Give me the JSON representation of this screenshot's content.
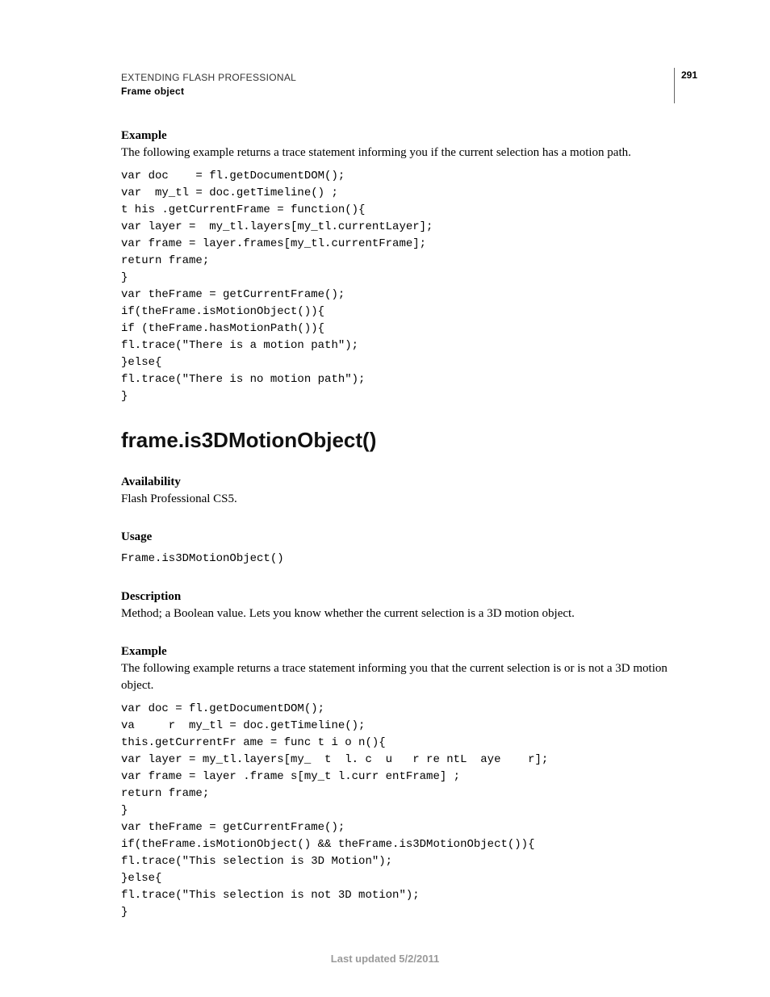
{
  "header": {
    "line1": "EXTENDING FLASH PROFESSIONAL",
    "line2": "Frame object",
    "page_number": "291"
  },
  "section1": {
    "label": "Example",
    "intro": "The following example returns a trace statement informing you if the current selection has a motion path.",
    "code": "var doc    = fl.getDocumentDOM();\nvar  my_tl = doc.getTimeline() ;\nt his .getCurrentFrame = function(){\nvar layer =  my_tl.layers[my_tl.currentLayer];\nvar frame = layer.frames[my_tl.currentFrame];\nreturn frame;\n}\nvar theFrame = getCurrentFrame();\nif(theFrame.isMotionObject()){\nif (theFrame.hasMotionPath()){\nfl.trace(\"There is a motion path\");\n}else{\nfl.trace(\"There is no motion path\");\n}"
  },
  "api": {
    "heading": "frame.is3DMotionObject()",
    "availability": {
      "label": "Availability",
      "text": "Flash Professional CS5."
    },
    "usage": {
      "label": "Usage",
      "code": "Frame.is3DMotionObject()"
    },
    "description": {
      "label": "Description",
      "text": "Method; a Boolean value. Lets you know whether the current selection is a 3D motion object."
    },
    "example2": {
      "label": "Example",
      "intro": "The following example returns a trace statement informing you that the current selection is or is not a 3D motion object.",
      "code": "var doc = fl.getDocumentDOM();\nva     r  my_tl = doc.getTimeline();\nthis.getCurrentFr ame = func t i o n(){\nvar layer = my_tl.layers[my_  t  l. c  u   r re ntL  aye    r];\nvar frame = layer .frame s[my_t l.curr entFrame] ;\nreturn frame;\n}\nvar theFrame = getCurrentFrame();\nif(theFrame.isMotionObject() && theFrame.is3DMotionObject()){\nfl.trace(\"This selection is 3D Motion\");\n}else{\nfl.trace(\"This selection is not 3D motion\");\n}"
    }
  },
  "footer": {
    "text": "Last updated 5/2/2011"
  }
}
